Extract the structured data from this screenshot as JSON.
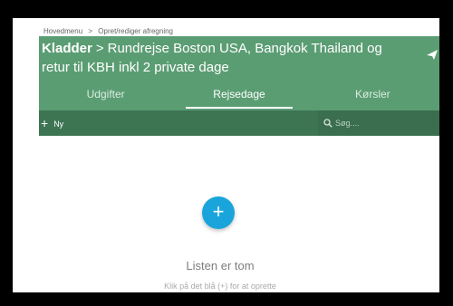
{
  "breadcrumb": [
    "Hovedmenu",
    ">",
    "Opret/rediger afregning"
  ],
  "header": {
    "title_lead": "Kladder",
    "title_sep": ">",
    "title_rest": "Rundrejse Boston USA, Bangkok Thailand og retur til KBH inkl 2 private dage"
  },
  "tabs": [
    "Udgifter",
    "Rejsedage",
    "Kørsler"
  ],
  "active_tab": "Rejsedage",
  "toolbar": {
    "new_label": "Ny",
    "search_placeholder": "Søg...."
  },
  "empty_state": {
    "title": "Listen er tom",
    "hint": "Klik på det blå (+) for at oprette"
  },
  "icons": {
    "add": "plus-icon",
    "search": "search-icon",
    "share": "share-icon"
  },
  "colors": {
    "header": "#5b9d73",
    "toolbar": "#3d7553",
    "fab": "#19a5dc"
  }
}
